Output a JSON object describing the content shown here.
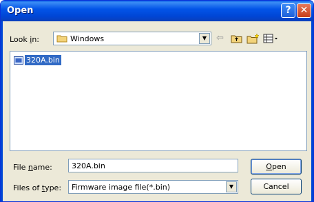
{
  "window": {
    "title": "Open",
    "help_glyph": "?",
    "close_glyph": "✕"
  },
  "lookin": {
    "label_prefix": "Look ",
    "label_underline": "i",
    "label_suffix": "n:",
    "value": "Windows",
    "icon": "folder-icon"
  },
  "toolbar": {
    "icons": [
      "back-arrow-icon",
      "up-folder-icon",
      "new-folder-icon",
      "views-menu-icon"
    ]
  },
  "files": [
    {
      "name": "320A.bin",
      "icon": "bin-file-icon",
      "selected": true
    }
  ],
  "filename": {
    "label_prefix": "File ",
    "label_underline": "n",
    "label_suffix": "ame:",
    "value": "320A.bin"
  },
  "filetype": {
    "label_prefix": "Files of ",
    "label_underline": "t",
    "label_suffix": "ype:",
    "value": "Firmware image file(*.bin)"
  },
  "buttons": {
    "open_underline": "O",
    "open_rest": "pen",
    "cancel": "Cancel"
  },
  "colors": {
    "titlebar": "#0046d5",
    "selection": "#316ac5",
    "dialog_bg": "#ece9d8"
  }
}
